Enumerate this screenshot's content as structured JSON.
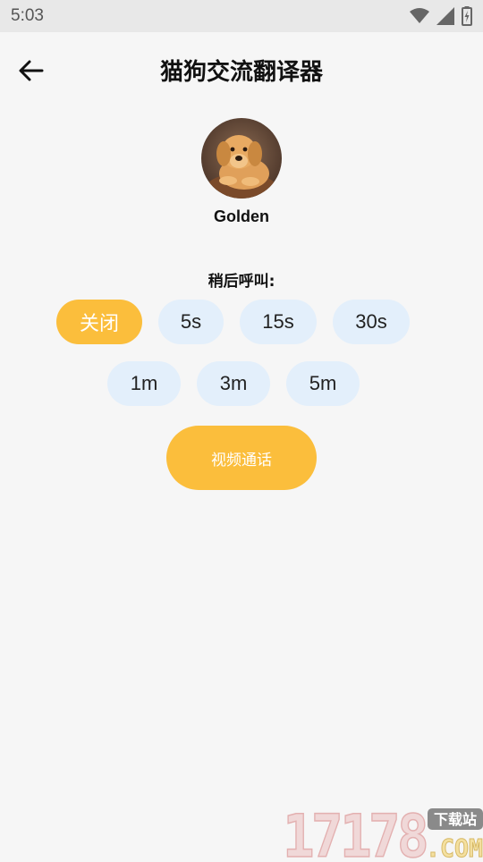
{
  "status_bar": {
    "time": "5:03",
    "icons": [
      "wifi-icon",
      "signal-icon",
      "battery-icon"
    ]
  },
  "header": {
    "title": "猫狗交流翻译器",
    "back_icon": "arrow-left-icon"
  },
  "pet": {
    "name": "Golden",
    "avatar": "golden-retriever-puppy-photo"
  },
  "call_later": {
    "label": "稍后呼叫:",
    "options": [
      "关闭",
      "5s",
      "15s",
      "30s",
      "1m",
      "3m",
      "5m"
    ],
    "selected": "关闭"
  },
  "video_call_button": "视频通话",
  "watermark": {
    "number": "17178",
    "domain": ".COM",
    "tag": "下载站"
  },
  "colors": {
    "accent": "#fbbe3c",
    "chip_bg": "#e3effb",
    "background": "#f6f6f6"
  }
}
